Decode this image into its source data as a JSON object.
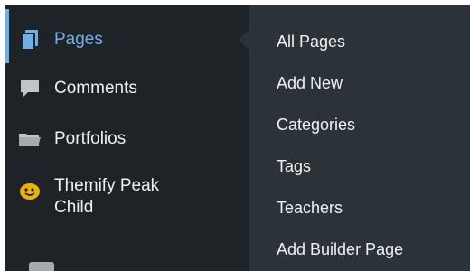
{
  "sidebar": {
    "items": [
      {
        "label": "Pages",
        "icon": "pages-icon",
        "current": true
      },
      {
        "label": "Comments",
        "icon": "comment-icon"
      },
      {
        "label": "Portfolios",
        "icon": "folder-icon"
      },
      {
        "label": "Themify Peak\nChild",
        "icon": "smiley-icon"
      }
    ]
  },
  "submenu": {
    "items": [
      {
        "label": "All Pages"
      },
      {
        "label": "Add New"
      },
      {
        "label": "Categories"
      },
      {
        "label": "Tags"
      },
      {
        "label": "Teachers"
      },
      {
        "label": "Add Builder Page"
      }
    ]
  },
  "colors": {
    "menu_bg": "#1d2327",
    "submenu_bg": "#2c3338",
    "accent": "#72aee6",
    "text": "#f0f0f1"
  }
}
